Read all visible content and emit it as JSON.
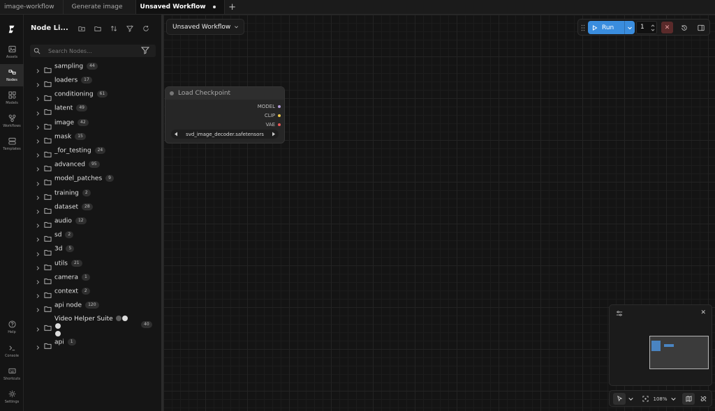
{
  "tabs": [
    {
      "label": "image-workflow"
    },
    {
      "label": "Generate image"
    },
    {
      "label": "Unsaved Workflow",
      "active": true,
      "dirty": true
    }
  ],
  "rail": {
    "items": [
      {
        "label": "Assets",
        "icon": "image-icon"
      },
      {
        "label": "Nodes",
        "icon": "nodes-icon",
        "active": true
      },
      {
        "label": "Models",
        "icon": "models-icon"
      },
      {
        "label": "Workflows",
        "icon": "workflow-icon"
      },
      {
        "label": "Templates",
        "icon": "templates-icon"
      }
    ],
    "bottom": [
      {
        "label": "Help",
        "icon": "help-icon"
      },
      {
        "label": "Console",
        "icon": "terminal-icon"
      },
      {
        "label": "Shortcuts",
        "icon": "keyboard-icon"
      },
      {
        "label": "Settings",
        "icon": "gear-icon"
      }
    ]
  },
  "library": {
    "title": "Node Li...",
    "search_placeholder": "Search Nodes...",
    "categories": [
      {
        "label": "sampling",
        "count": "44"
      },
      {
        "label": "loaders",
        "count": "17"
      },
      {
        "label": "conditioning",
        "count": "61"
      },
      {
        "label": "latent",
        "count": "49"
      },
      {
        "label": "image",
        "count": "42"
      },
      {
        "label": "mask",
        "count": "15"
      },
      {
        "label": "_for_testing",
        "count": "24"
      },
      {
        "label": "advanced",
        "count": "95"
      },
      {
        "label": "model_patches",
        "count": "9"
      },
      {
        "label": "training",
        "count": "2"
      },
      {
        "label": "dataset",
        "count": "28"
      },
      {
        "label": "audio",
        "count": "12"
      },
      {
        "label": "sd",
        "count": "2"
      },
      {
        "label": "3d",
        "count": "5"
      },
      {
        "label": "utils",
        "count": "21"
      },
      {
        "label": "camera",
        "count": "1"
      },
      {
        "label": "context",
        "count": "2"
      },
      {
        "label": "api node",
        "count": "120"
      }
    ],
    "video_helper": {
      "label": "Video Helper Suite",
      "count": "40"
    },
    "last": {
      "label": "api",
      "count": "1"
    }
  },
  "workflow_selector": {
    "label": "Unsaved Workflow"
  },
  "node": {
    "title": "Load Checkpoint",
    "outputs": [
      {
        "label": "MODEL",
        "color": "#b39ddb"
      },
      {
        "label": "CLIP",
        "color": "#f2c94c"
      },
      {
        "label": "VAE",
        "color": "#eb5757"
      }
    ],
    "widget_value": "svd_image_decoder.safetensors"
  },
  "run": {
    "label": "Run",
    "count": "1",
    "accent": "#3a8dde"
  },
  "zoom": {
    "label": "108%"
  }
}
